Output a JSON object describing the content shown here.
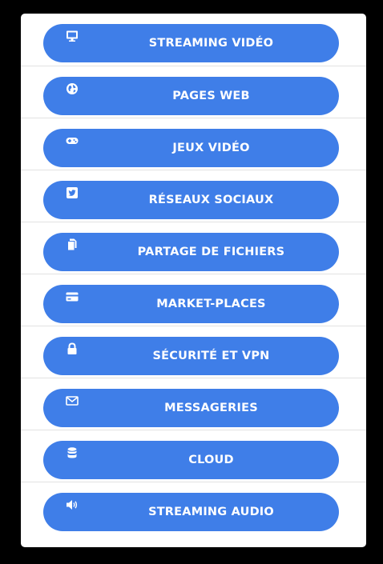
{
  "menu": {
    "items": [
      {
        "label": "STREAMING VIDÉO",
        "icon": "monitor-icon"
      },
      {
        "label": "PAGES WEB",
        "icon": "globe-icon"
      },
      {
        "label": "JEUX VIDÉO",
        "icon": "gamepad-icon"
      },
      {
        "label": "RÉSEAUX SOCIAUX",
        "icon": "twitter-icon"
      },
      {
        "label": "PARTAGE DE FICHIERS",
        "icon": "files-icon"
      },
      {
        "label": "MARKET-PLACES",
        "icon": "credit-card-icon"
      },
      {
        "label": "SÉCURITÉ ET VPN",
        "icon": "lock-icon"
      },
      {
        "label": "MESSAGERIES",
        "icon": "envelope-icon"
      },
      {
        "label": "CLOUD",
        "icon": "database-icon"
      },
      {
        "label": "STREAMING AUDIO",
        "icon": "volume-icon"
      }
    ]
  },
  "colors": {
    "button": "#3f7ee8",
    "panel": "#ffffff",
    "background": "#000000",
    "divider": "#e2e2e2"
  }
}
